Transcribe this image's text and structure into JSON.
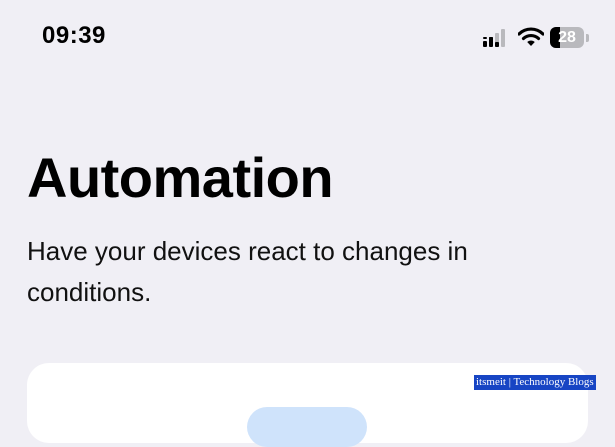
{
  "status_bar": {
    "time": "09:39",
    "battery_level": "28",
    "battery_fraction": 0.28,
    "signal_icon": "cellular-signal-icon",
    "wifi_icon": "wifi-icon",
    "battery_icon": "battery-icon"
  },
  "header": {
    "title": "Automation",
    "subtitle": "Have your devices react to changes in conditions."
  },
  "watermark": "itsmeit | Technology Blogs",
  "colors": {
    "background": "#f0eff5",
    "card": "#ffffff",
    "accent_light": "#cfe3fb",
    "watermark_bg": "#1745c4"
  }
}
